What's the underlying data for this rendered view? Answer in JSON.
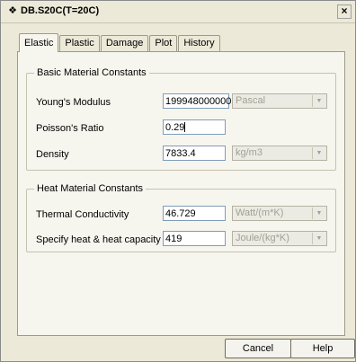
{
  "window": {
    "title": "DB.S20C(T=20C)",
    "title_icon": "material-icon",
    "close_label": "×"
  },
  "tabs": [
    {
      "label": "Elastic",
      "active": true
    },
    {
      "label": "Plastic",
      "active": false
    },
    {
      "label": "Damage",
      "active": false
    },
    {
      "label": "Plot",
      "active": false
    },
    {
      "label": "History",
      "active": false
    }
  ],
  "basic": {
    "title": "Basic Material Constants",
    "rows": [
      {
        "label": "Young's Modulus",
        "value": "199948000000",
        "unit": "Pascal"
      },
      {
        "label": "Poisson's Ratio",
        "value": "0.29"
      },
      {
        "label": "Density",
        "value": "7833.4",
        "unit": "kg/m3"
      }
    ]
  },
  "heat": {
    "title": "Heat Material Constants",
    "rows": [
      {
        "label": "Thermal Conductivity",
        "value": "46.729",
        "unit": "Watt/(m*K)"
      },
      {
        "label": "Specify heat & heat capacity",
        "value": "419",
        "unit": "Joule/(kg*K)"
      }
    ]
  },
  "buttons": {
    "cancel": "Cancel",
    "help": "Help"
  }
}
